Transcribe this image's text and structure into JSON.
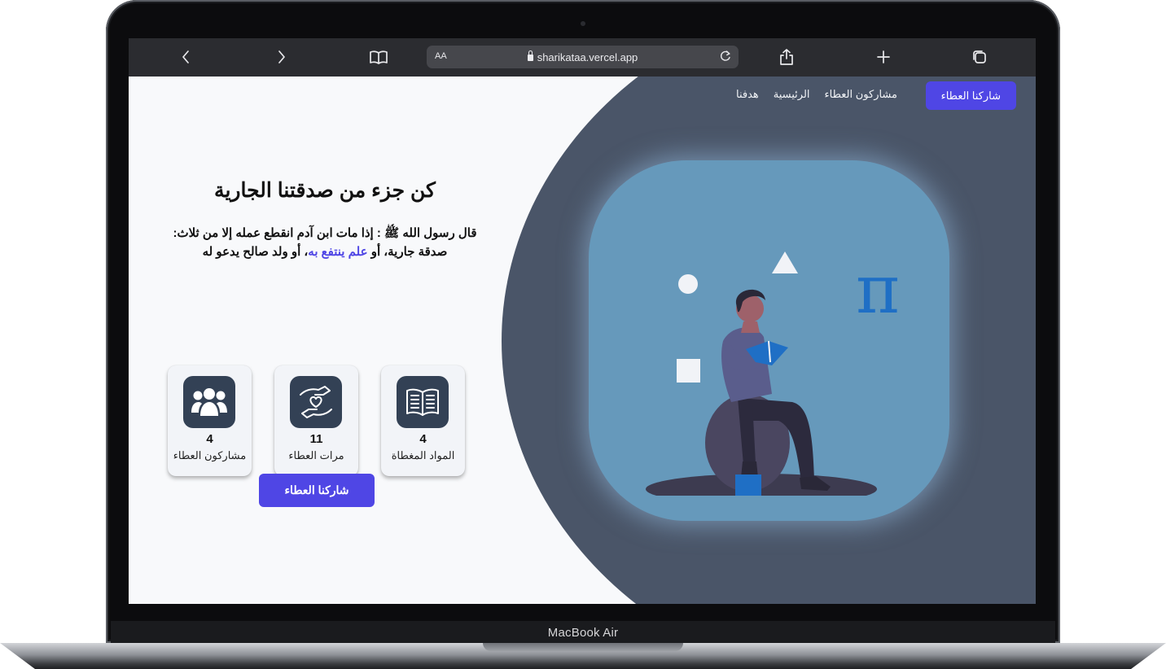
{
  "device": {
    "label": "MacBook Air"
  },
  "browser": {
    "reader_label": "AA",
    "url": "sharikataa.vercel.app",
    "icons": [
      "back-icon",
      "forward-icon",
      "bookmarks-icon",
      "lock-icon",
      "reload-icon",
      "share-icon",
      "new-tab-icon",
      "tabs-icon"
    ]
  },
  "nav": {
    "cta_label": "شاركنا العطاء",
    "links": [
      "مشاركون العطاء",
      "الرئيسية",
      "هدفنا"
    ]
  },
  "hero": {
    "title": "كن جزء من صدقتنا الجارية",
    "hadith_part1": "قال رسول الله ﷺ : إذا مات ابن آدم انقطع عمله إلا من ثلاث: صدقة جارية، أو ",
    "hadith_accent": "علم ينتفع به",
    "hadith_part2": "، أو ولد صالح يدعو له"
  },
  "stats": [
    {
      "value": "4",
      "label": "المواد المغطاة",
      "icon": "open-book-icon"
    },
    {
      "value": "11",
      "label": "مرات العطاء",
      "icon": "giving-hands-heart-icon"
    },
    {
      "value": "4",
      "label": "مشاركون العطاء",
      "icon": "users-group-icon"
    }
  ],
  "cta": {
    "label": "شاركنا العطاء"
  },
  "colors": {
    "accent": "#4f46e5",
    "panel": "#4a5568",
    "blob": "#6699bb",
    "icon_tile": "#334155"
  }
}
